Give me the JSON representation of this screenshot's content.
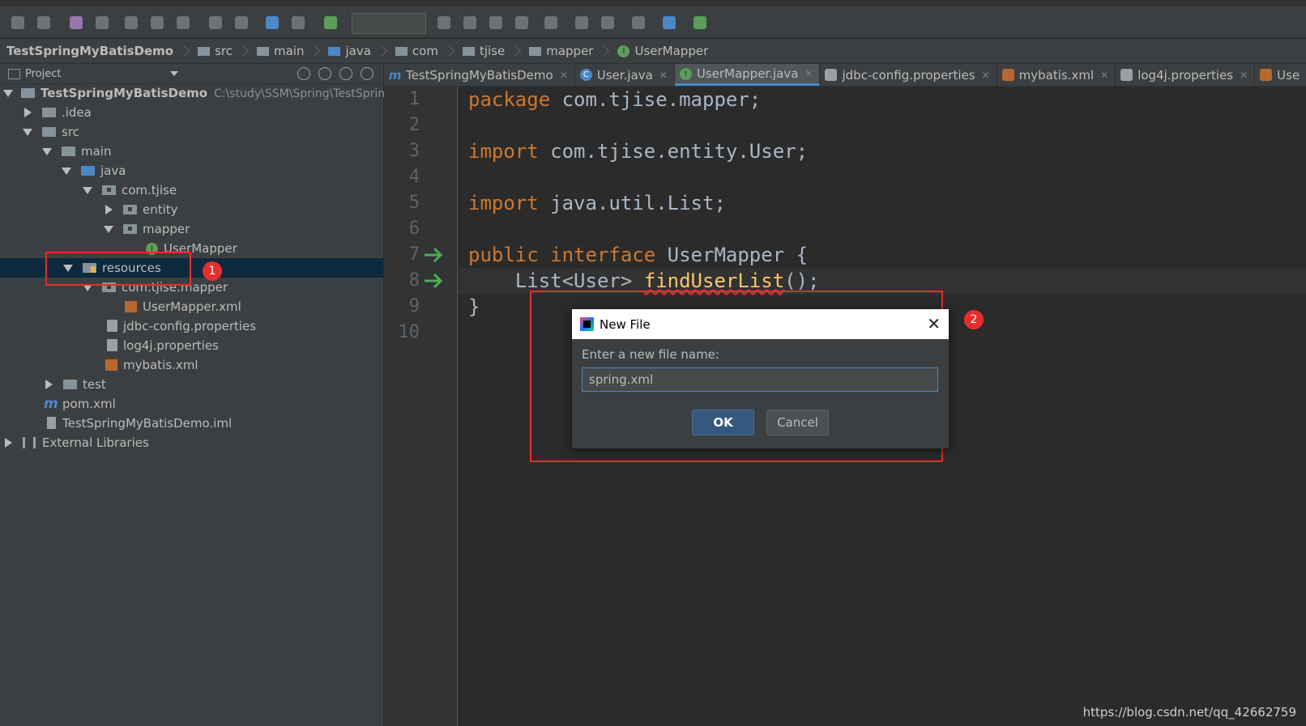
{
  "breadcrumb": {
    "items": [
      {
        "label": "TestSpringMyBatisDemo"
      },
      {
        "label": "src"
      },
      {
        "label": "main"
      },
      {
        "label": "java"
      },
      {
        "label": "com"
      },
      {
        "label": "tjise"
      },
      {
        "label": "mapper"
      },
      {
        "label": "UserMapper"
      }
    ]
  },
  "project_panel": {
    "title": "Project",
    "tree": [
      {
        "label": "TestSpringMyBatisDemo",
        "path": "C:\\study\\SSM\\Spring\\TestSprin"
      },
      {
        "label": ".idea"
      },
      {
        "label": "src"
      },
      {
        "label": "main"
      },
      {
        "label": "java"
      },
      {
        "label": "com.tjise"
      },
      {
        "label": "entity"
      },
      {
        "label": "mapper"
      },
      {
        "label": "UserMapper"
      },
      {
        "label": "resources"
      },
      {
        "label": "com.tjise.mapper"
      },
      {
        "label": "UserMapper.xml"
      },
      {
        "label": "jdbc-config.properties"
      },
      {
        "label": "log4j.properties"
      },
      {
        "label": "mybatis.xml"
      },
      {
        "label": "test"
      },
      {
        "label": "pom.xml"
      },
      {
        "label": "TestSpringMyBatisDemo.iml"
      },
      {
        "label": "External Libraries"
      }
    ]
  },
  "tabs": [
    {
      "label": "TestSpringMyBatisDemo"
    },
    {
      "label": "User.java"
    },
    {
      "label": "UserMapper.java"
    },
    {
      "label": "jdbc-config.properties"
    },
    {
      "label": "mybatis.xml"
    },
    {
      "label": "log4j.properties"
    },
    {
      "label": "Use"
    }
  ],
  "editor": {
    "line_numbers": [
      "1",
      "2",
      "3",
      "4",
      "5",
      "6",
      "7",
      "8",
      "9",
      "10"
    ],
    "code": {
      "l1_kw": "package",
      "l1_rest": " com.tjise.mapper;",
      "l3_kw": "import",
      "l3_rest": " com.tjise.entity.User;",
      "l5_kw": "import",
      "l5_rest": " java.util.List;",
      "l7_kw1": "public",
      "l7_kw2": " interface",
      "l7_rest": " UserMapper {",
      "l8_type": "    List<User> ",
      "l8_fn": "findUserList",
      "l8_rest": "();",
      "l9": "}"
    }
  },
  "dialog": {
    "title": "New File",
    "label": "Enter a new file name:",
    "input_value": "spring.xml",
    "ok_label": "OK",
    "cancel_label": "Cancel"
  },
  "annotations": {
    "badge1": "1",
    "badge2": "2"
  },
  "watermark": "https://blog.csdn.net/qq_42662759",
  "colors": {
    "accent": "#4a88c7",
    "annotation_red": "#e82d2d",
    "keyword": "#cc7832"
  }
}
